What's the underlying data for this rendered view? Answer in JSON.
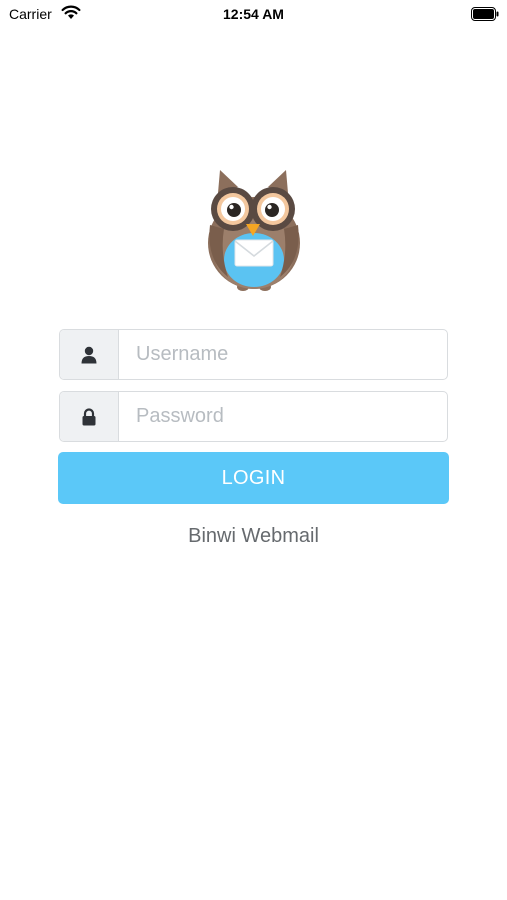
{
  "status_bar": {
    "carrier": "Carrier",
    "time": "12:54 AM",
    "icons": [
      "wifi-icon",
      "battery-icon"
    ]
  },
  "logo": {
    "icon": "owl-mail-logo"
  },
  "login_form": {
    "username": {
      "placeholder": "Username",
      "value": "",
      "icon": "user-icon"
    },
    "password": {
      "placeholder": "Password",
      "value": "",
      "icon": "lock-icon"
    },
    "login_label": "LOGIN"
  },
  "app_name": "Binwi Webmail",
  "colors": {
    "accent": "#5bc8f8",
    "field_border": "#d9dcdf",
    "addon_bg": "#eff1f3",
    "placeholder": "#b7bcc1",
    "footer_text": "#666a6e"
  }
}
